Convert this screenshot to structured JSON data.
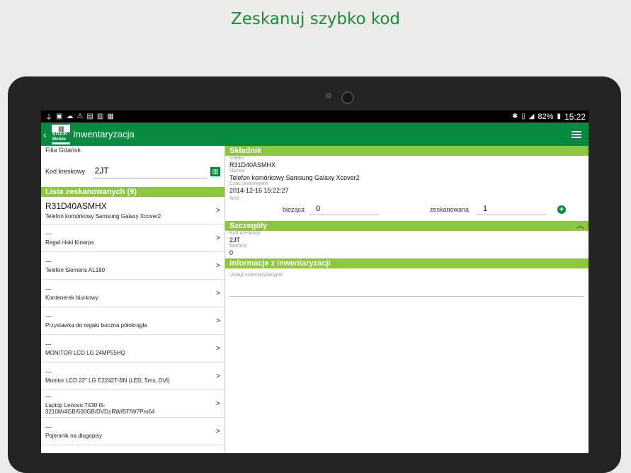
{
  "promo_title": "Zeskanuj szybko kod",
  "statusbar": {
    "left_icons": [
      "usb-icon",
      "image-icon",
      "cloud-upload-icon",
      "warning-icon",
      "store-icon",
      "briefcase-icon",
      "camera-icon"
    ],
    "battery": "82%",
    "time": "15:22"
  },
  "actionbar": {
    "back": "‹",
    "logo_text": "STOCK Mobile",
    "title": "Inwentaryzacja"
  },
  "left": {
    "branch": "Filia Gdańsk",
    "barcode_label": "Kod kreskowy",
    "barcode_value": "2JT",
    "list_header": "Lista zeskanowanych (9)",
    "items": [
      {
        "code": "R31D40ASMHX",
        "name": "Telefon komórkowy Samsung Galaxy Xcover2"
      },
      {
        "code": "---",
        "name": "Regał niski Kinarps"
      },
      {
        "code": "---",
        "name": "Telefon Siemens AL180"
      },
      {
        "code": "---",
        "name": "Kontenerek biurkowy"
      },
      {
        "code": "---",
        "name": "Przystawka do regału boczna półokrągła"
      },
      {
        "code": "---",
        "name": "MONITOR LCD LG 24MP55HQ"
      },
      {
        "code": "---",
        "name": "Monitor LCD 22\" LG E2242T-BN (LED, 5ms, DVI)"
      },
      {
        "code": "---",
        "name": "Laptop Lenovo T430 i5-3210M/4GB/500GB/DVD±RW/BT/W7Pro64"
      },
      {
        "code": "---",
        "name": "Pojemnik na długopisy"
      }
    ],
    "arrow": ">"
  },
  "right": {
    "component_header": "Składnik",
    "index_label": "Indeks",
    "index_value": "R31D40ASMHX",
    "name_label": "Nazwa",
    "name_value": "Telefon komórkowy Samsung Galaxy Xcover2",
    "scan_time_label": "Czas skanowania",
    "scan_time_value": "2014-12-16 15:22:27",
    "qty_label": "Ilość",
    "current_label": "bieżąca",
    "current_value": "0",
    "scanned_label": "zeskanowana",
    "scanned_value": "1",
    "details_header": "Szczegóły",
    "barcode_label": "Kod kreskowy",
    "barcode_value": "2JT",
    "value_label": "Wartość",
    "value_value": "0",
    "info_header": "Informacje z inwentaryzacji",
    "notes_label": "Uwagi inwentaryzacyjne"
  }
}
